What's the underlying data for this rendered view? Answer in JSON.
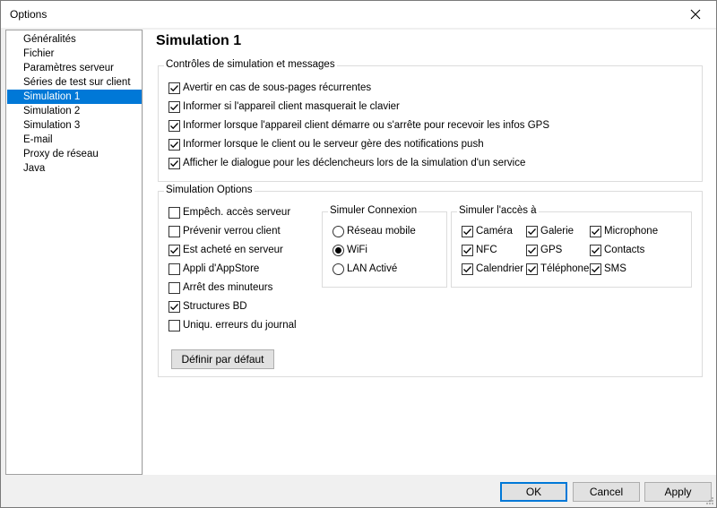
{
  "window": {
    "title": "Options"
  },
  "sidebar": {
    "items": [
      {
        "label": "Généralités",
        "selected": false
      },
      {
        "label": "Fichier",
        "selected": false
      },
      {
        "label": "Paramètres serveur",
        "selected": false
      },
      {
        "label": "Séries de test sur client",
        "selected": false
      },
      {
        "label": "Simulation 1",
        "selected": true
      },
      {
        "label": "Simulation 2",
        "selected": false
      },
      {
        "label": "Simulation 3",
        "selected": false
      },
      {
        "label": "E-mail",
        "selected": false
      },
      {
        "label": "Proxy de réseau",
        "selected": false
      },
      {
        "label": "Java",
        "selected": false
      }
    ]
  },
  "main": {
    "title": "Simulation 1",
    "controls_group": {
      "label": "Contrôles de simulation et messages",
      "options": [
        {
          "label": "Avertir en cas de sous-pages récurrentes",
          "checked": true
        },
        {
          "label": "Informer si l'appareil client masquerait le clavier",
          "checked": true
        },
        {
          "label": "Informer lorsque l'appareil client démarre ou s'arrête pour recevoir les infos GPS",
          "checked": true
        },
        {
          "label": "Informer lorsque le client ou le serveur gère des notifications push",
          "checked": true
        },
        {
          "label": "Afficher le dialogue pour les déclencheurs lors de la simulation d'un service",
          "checked": true
        }
      ]
    },
    "sim_options": {
      "label": "Simulation Options",
      "options": [
        {
          "label": "Empêch. accès serveur",
          "checked": false
        },
        {
          "label": "Prévenir verrou client",
          "checked": false
        },
        {
          "label": "Est acheté en serveur",
          "checked": true
        },
        {
          "label": "Appli d'AppStore",
          "checked": false
        },
        {
          "label": "Arrêt des minuteurs",
          "checked": false
        },
        {
          "label": "Structures BD",
          "checked": true
        },
        {
          "label": "Uniqu. erreurs du journal",
          "checked": false
        }
      ],
      "default_button": "Définir par défaut"
    },
    "connexion": {
      "label": "Simuler Connexion",
      "options": [
        {
          "label": "Réseau mobile",
          "selected": false
        },
        {
          "label": "WiFi",
          "selected": true
        },
        {
          "label": "LAN Activé",
          "selected": false
        }
      ]
    },
    "access": {
      "label": "Simuler l'accès à",
      "options": [
        {
          "label": "Caméra",
          "checked": true
        },
        {
          "label": "Galerie",
          "checked": true
        },
        {
          "label": "Microphone",
          "checked": true
        },
        {
          "label": "NFC",
          "checked": true
        },
        {
          "label": "GPS",
          "checked": true
        },
        {
          "label": "Contacts",
          "checked": true
        },
        {
          "label": "Calendrier",
          "checked": true
        },
        {
          "label": "Téléphone",
          "checked": true
        },
        {
          "label": "SMS",
          "checked": true
        }
      ]
    }
  },
  "footer": {
    "ok": "OK",
    "cancel": "Cancel",
    "apply": "Apply"
  },
  "colors": {
    "accent": "#0078d7"
  },
  "icons": {
    "close": "close-icon",
    "check": "checkmark-icon"
  }
}
